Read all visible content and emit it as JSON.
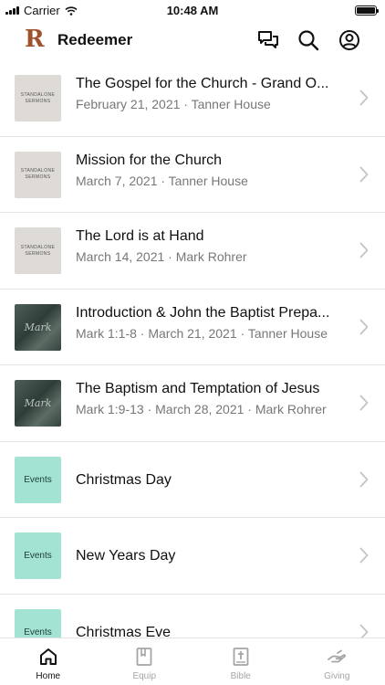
{
  "status_bar": {
    "carrier": "Carrier",
    "time": "10:48 AM"
  },
  "header": {
    "logo": "R",
    "title": "Redeemer"
  },
  "items": [
    {
      "thumb_type": "standalone",
      "thumb_text": "STANDALONE\nSERMONS",
      "title": "The Gospel for the Church - Grand O...",
      "subtitle": "February 21, 2021 · Tanner House"
    },
    {
      "thumb_type": "standalone",
      "thumb_text": "STANDALONE\nSERMONS",
      "title": "Mission for the Church",
      "subtitle": "March 7, 2021 · Tanner House"
    },
    {
      "thumb_type": "standalone",
      "thumb_text": "STANDALONE\nSERMONS",
      "title": "The Lord is at Hand",
      "subtitle": "March 14, 2021 · Mark Rohrer"
    },
    {
      "thumb_type": "mark",
      "thumb_text": "Mark",
      "title": "Introduction & John the Baptist Prepa...",
      "subtitle": "Mark 1:1-8 · March 21, 2021 · Tanner House"
    },
    {
      "thumb_type": "mark",
      "thumb_text": "Mark",
      "title": "The Baptism and Temptation of Jesus",
      "subtitle": "Mark 1:9-13 · March 28, 2021 · Mark Rohrer"
    },
    {
      "thumb_type": "events",
      "thumb_text": "Events",
      "title": "Christmas Day",
      "subtitle": ""
    },
    {
      "thumb_type": "events",
      "thumb_text": "Events",
      "title": "New Years Day",
      "subtitle": ""
    },
    {
      "thumb_type": "events",
      "thumb_text": "Events",
      "title": "Christmas Eve",
      "subtitle": ""
    }
  ],
  "tabs": [
    {
      "label": "Home",
      "icon": "home-icon",
      "active": true
    },
    {
      "label": "Equip",
      "icon": "bookmark-book-icon",
      "active": false
    },
    {
      "label": "Bible",
      "icon": "bible-icon",
      "active": false
    },
    {
      "label": "Giving",
      "icon": "giving-hand-icon",
      "active": false
    }
  ],
  "colors": {
    "logo": "#a0522d",
    "events_thumb": "#a3e3d3",
    "standalone_thumb": "#dedad5",
    "active_tab": "#111111",
    "inactive_tab": "#a5a5a5"
  }
}
